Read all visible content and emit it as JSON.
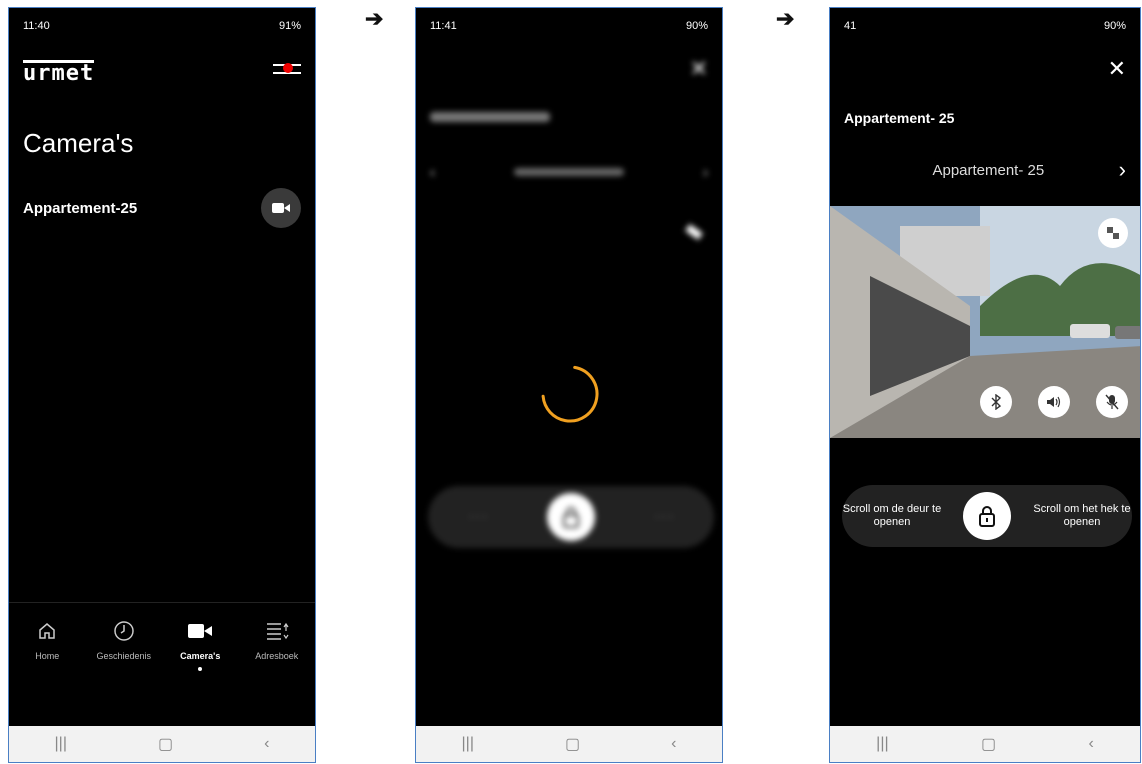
{
  "screen1": {
    "status_time": "11:40",
    "status_right": "91%",
    "logo": "urmet",
    "title": "Camera's",
    "apartment": "Appartement-25",
    "tabs": [
      {
        "label": "Home",
        "icon": "home-icon"
      },
      {
        "label": "Geschiedenis",
        "icon": "clock-icon"
      },
      {
        "label": "Camera's",
        "icon": "video-camera-icon"
      },
      {
        "label": "Adresboek",
        "icon": "address-book-icon"
      }
    ]
  },
  "screen2": {
    "status_time": "11:41",
    "status_right": "90%"
  },
  "screen3": {
    "status_time": "41",
    "status_right": "90%",
    "apartment_title": "Appartement- 25",
    "selector_label": "Appartement- 25",
    "scroll_left": "Scroll om de deur te openen",
    "scroll_right": "Scroll om het hek te openen"
  },
  "colors": {
    "accent_red": "#e00000",
    "spinner": "#f0a020",
    "frame_border": "#4a7fc4"
  }
}
